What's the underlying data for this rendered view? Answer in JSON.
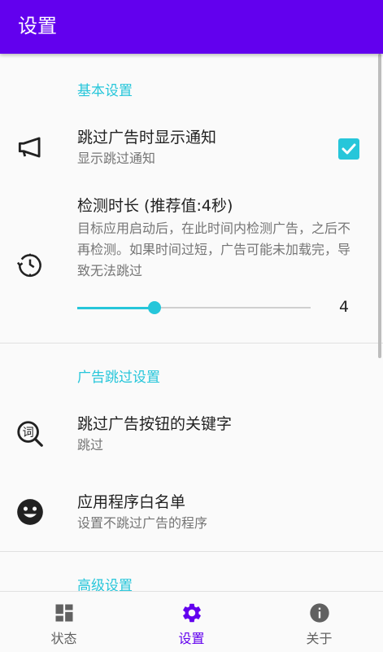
{
  "appbar": {
    "title": "设置"
  },
  "colors": {
    "primary": "#6200ee",
    "accent": "#26c6da"
  },
  "sections": {
    "basic": {
      "header": "基本设置",
      "skip_notification": {
        "title": "跳过广告时显示通知",
        "summary": "显示跳过通知",
        "checked": true,
        "icon": "megaphone-icon"
      },
      "detect_duration": {
        "title": "检测时长 (推荐值:4秒)",
        "summary": "目标应用启动后，在此时间内检测广告，之后不再检测。如果时间过短，广告可能未加载完，导致无法跳过",
        "value": "4",
        "slider_fraction": 0.33,
        "icon": "timer-history-icon"
      }
    },
    "ad_skip": {
      "header": "广告跳过设置",
      "keywords": {
        "title": "跳过广告按钮的关键字",
        "summary": "跳过",
        "icon": "word-search-icon",
        "icon_char": "词"
      },
      "whitelist": {
        "title": "应用程序白名单",
        "summary": "设置不跳过广告的程序",
        "icon": "smiley-icon"
      }
    },
    "advanced": {
      "header": "高级设置"
    }
  },
  "bottom_nav": {
    "items": [
      {
        "label": "状态",
        "icon": "dashboard-icon",
        "active": false
      },
      {
        "label": "设置",
        "icon": "gear-icon",
        "active": true
      },
      {
        "label": "关于",
        "icon": "info-icon",
        "active": false
      }
    ]
  }
}
